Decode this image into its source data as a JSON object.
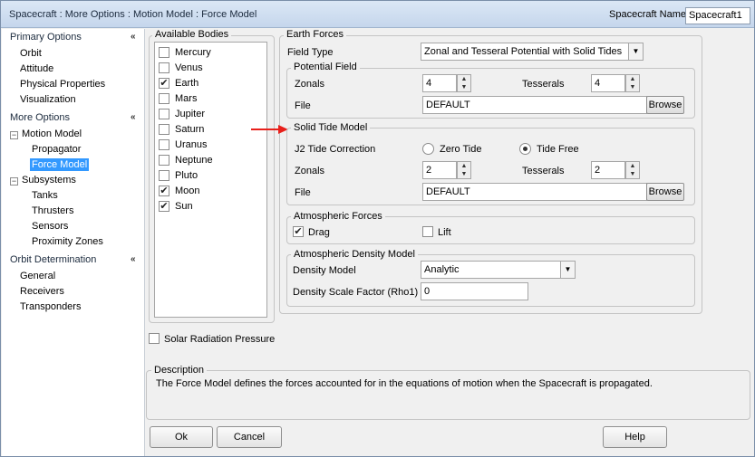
{
  "window": {
    "title": "Spacecraft : More Options : Motion Model : Force Model",
    "spacecraft_name_label": "Spacecraft Name",
    "spacecraft_name_value": "Spacecraft1"
  },
  "sidebar": {
    "primary_header": "Primary Options",
    "primary_items": [
      "Orbit",
      "Attitude",
      "Physical Properties",
      "Visualization"
    ],
    "more_header": "More Options",
    "motion_model": "Motion Model",
    "motion_children": [
      "Propagator",
      "Force Model"
    ],
    "subsystems": "Subsystems",
    "subsystem_children": [
      "Tanks",
      "Thrusters",
      "Sensors",
      "Proximity Zones"
    ],
    "orbit_det_header": "Orbit Determination",
    "orbit_det_items": [
      "General",
      "Receivers",
      "Transponders"
    ],
    "selected_item": "Force Model",
    "collapse_glyph": "«",
    "tree_toggle_glyph": "−"
  },
  "available_bodies": {
    "label": "Available Bodies",
    "check_glyph": "✔",
    "items": [
      {
        "name": "Mercury",
        "checked": false
      },
      {
        "name": "Venus",
        "checked": false
      },
      {
        "name": "Earth",
        "checked": true
      },
      {
        "name": "Mars",
        "checked": false
      },
      {
        "name": "Jupiter",
        "checked": false
      },
      {
        "name": "Saturn",
        "checked": false
      },
      {
        "name": "Uranus",
        "checked": false
      },
      {
        "name": "Neptune",
        "checked": false
      },
      {
        "name": "Pluto",
        "checked": false
      },
      {
        "name": "Moon",
        "checked": true
      },
      {
        "name": "Sun",
        "checked": true
      }
    ]
  },
  "earth_forces": {
    "label": "Earth Forces",
    "field_type_label": "Field Type",
    "field_type_value": "Zonal and Tesseral Potential with Solid Tides",
    "potential_field": {
      "label": "Potential Field",
      "zonals_label": "Zonals",
      "zonals_value": "4",
      "tesserals_label": "Tesserals",
      "tesserals_value": "4",
      "file_label": "File",
      "file_value": "DEFAULT",
      "browse_label": "Browse"
    },
    "solid_tide": {
      "label": "Solid Tide Model",
      "j2_label": "J2 Tide Correction",
      "zero_tide_label": "Zero Tide",
      "tide_free_label": "Tide Free",
      "selected": "Tide Free",
      "zonals_label": "Zonals",
      "zonals_value": "2",
      "tesserals_label": "Tesserals",
      "tesserals_value": "2",
      "file_label": "File",
      "file_value": "DEFAULT",
      "browse_label": "Browse"
    },
    "atmospheric_forces": {
      "label": "Atmospheric Forces",
      "drag_label": "Drag",
      "drag_checked": true,
      "lift_label": "Lift",
      "lift_checked": false
    },
    "atmospheric_density": {
      "label": "Atmospheric Density Model",
      "density_model_label": "Density Model",
      "density_model_value": "Analytic",
      "scale_factor_label": "Density Scale Factor (Rho1)",
      "scale_factor_value": "0"
    }
  },
  "solar_radiation": {
    "label": "Solar Radiation Pressure",
    "checked": false
  },
  "description": {
    "label": "Description",
    "text": "The Force Model defines the forces accounted for in the equations of motion when the Spacecraft is propagated."
  },
  "buttons": {
    "ok": "Ok",
    "cancel": "Cancel",
    "help": "Help"
  },
  "colors": {
    "selection": "#3399ff",
    "annotation_arrow": "#e8201b",
    "title_bar": "#c5d6ec"
  }
}
